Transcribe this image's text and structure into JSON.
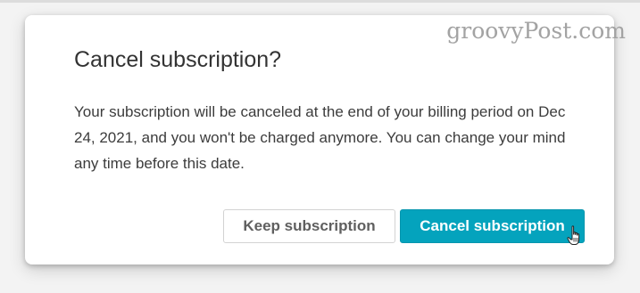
{
  "watermark": "groovyPost.com",
  "dialog": {
    "title": "Cancel subscription?",
    "message": "Your subscription will be canceled at the end of your billing period on Dec 24, 2021, and you won't be charged anymore. You can change your mind any time before this date.",
    "keep_button_label": "Keep subscription",
    "cancel_button_label": "Cancel subscription"
  },
  "colors": {
    "primary_button": "#04a3bd",
    "secondary_button_text": "#5f5f5f",
    "watermark": "#a3a3a3"
  },
  "icons": {
    "cursor": "hand-pointer-icon"
  }
}
